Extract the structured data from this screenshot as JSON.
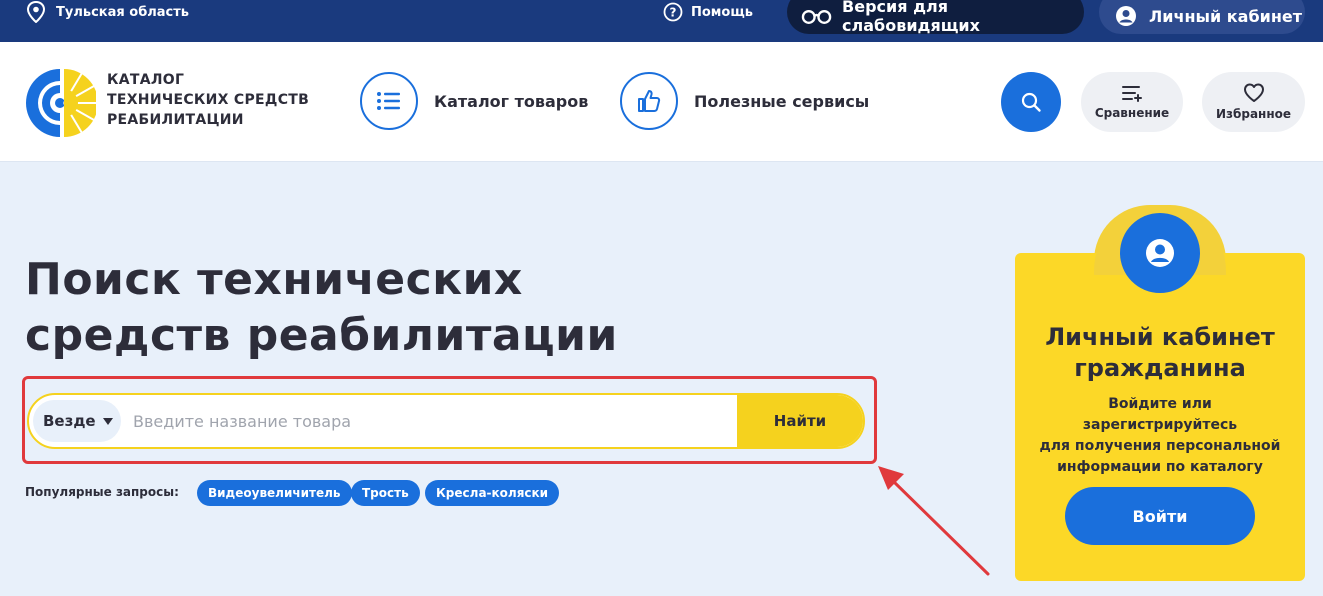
{
  "topbar": {
    "region": "Тульская область",
    "help": "Помощь",
    "accessibility": "Версия для слабовидящих",
    "account": "Личный кабинет"
  },
  "header": {
    "logo_lines": [
      "КАТАЛОГ",
      "ТЕХНИЧЕСКИХ СРЕДСТВ",
      "РЕАБИЛИТАЦИИ"
    ],
    "nav": [
      {
        "label": "Каталог товаров",
        "icon": "list-icon"
      },
      {
        "label": "Полезные сервисы",
        "icon": "thumbs-up-icon"
      }
    ],
    "compare": "Сравнение",
    "favorites": "Избранное"
  },
  "hero": {
    "title_line1": "Поиск технических",
    "title_line2": "средств реабилитации",
    "search": {
      "scope": "Везде",
      "placeholder": "Введите название товара",
      "value": "",
      "submit": "Найти"
    },
    "popular_label": "Популярные запросы:",
    "popular": [
      "Видеоувеличитель",
      "Трость",
      "Кресла-коляски"
    ]
  },
  "sidebar_card": {
    "title_line1": "Личный кабинет",
    "title_line2": "гражданина",
    "text_line1": "Войдите или зарегистрируйтесь",
    "text_line2": "для получения персональной",
    "text_line3": "информации по каталогу",
    "button": "Войти"
  },
  "colors": {
    "topbar": "#1a3a7e",
    "accent_blue": "#1a6fdc",
    "accent_yellow": "#fcd827",
    "annotation_red": "#e0393c"
  }
}
